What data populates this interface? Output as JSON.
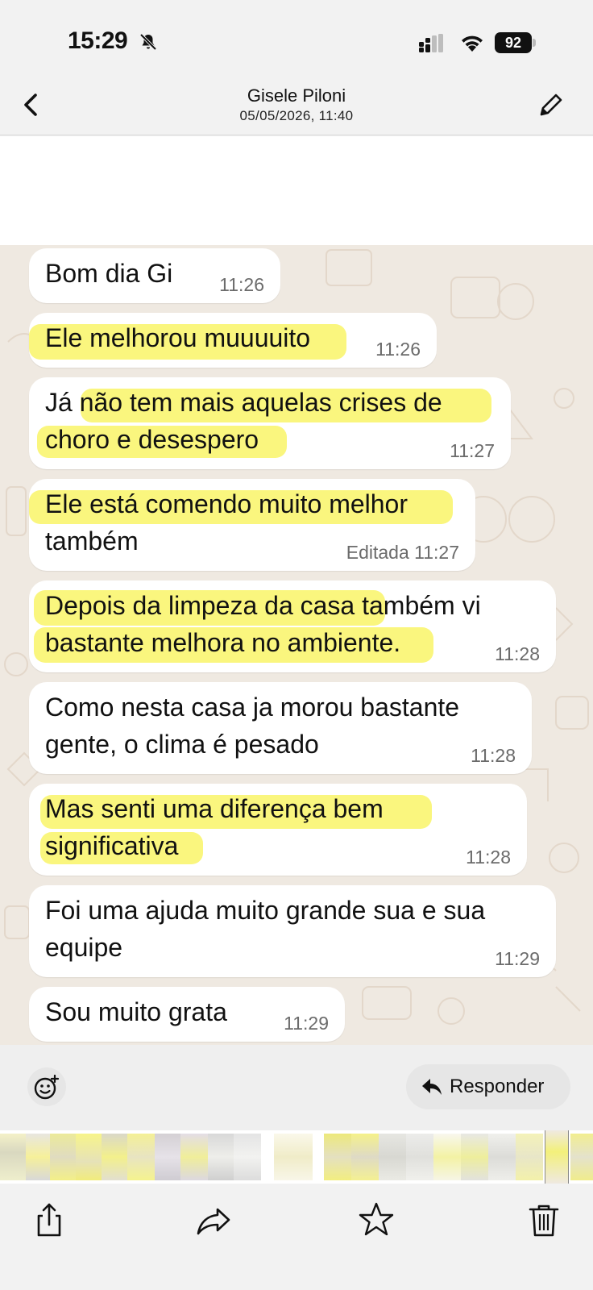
{
  "status_bar": {
    "time": "15:29",
    "battery": "92",
    "icons": [
      "bell-slash-icon",
      "signal-icon",
      "wifi-icon",
      "battery-icon"
    ]
  },
  "header": {
    "title": "Gisele Piloni",
    "subtitle": "05/05/2026, 11:40",
    "back_icon": "chevron-left-icon",
    "edit_icon": "pencil-icon"
  },
  "messages": [
    {
      "lines": [
        "Bom dia Gi"
      ],
      "time": "11:26"
    },
    {
      "lines": [
        "Ele melhorou muuuuito"
      ],
      "time": "11:26"
    },
    {
      "lines": [
        "Já não tem mais aquelas crises de",
        "choro e desespero"
      ],
      "time": "11:27"
    },
    {
      "lines": [
        "Ele está comendo muito melhor",
        "também"
      ],
      "time": "Editada 11:27"
    },
    {
      "lines": [
        "Depois da limpeza da casa também vi",
        "bastante melhora no ambiente."
      ],
      "time": "11:28"
    },
    {
      "lines": [
        "Como nesta casa ja morou bastante",
        "gente, o clima é pesado"
      ],
      "time": "11:28"
    },
    {
      "lines": [
        "Mas senti uma diferença bem",
        "significativa"
      ],
      "time": "11:28"
    },
    {
      "lines": [
        "Foi uma ajuda muito grande sua e sua",
        "equipe"
      ],
      "time": "11:29"
    },
    {
      "lines": [
        "Sou muito grata"
      ],
      "time": "11:29"
    }
  ],
  "highlight_color": "#f8f45a",
  "action_bar": {
    "emoji_icon": "add-reaction-icon",
    "reply_label": "Responder",
    "reply_icon": "reply-arrow-icon"
  },
  "toolbar": {
    "icons": [
      "share-icon",
      "forward-icon",
      "star-icon",
      "trash-icon"
    ]
  }
}
